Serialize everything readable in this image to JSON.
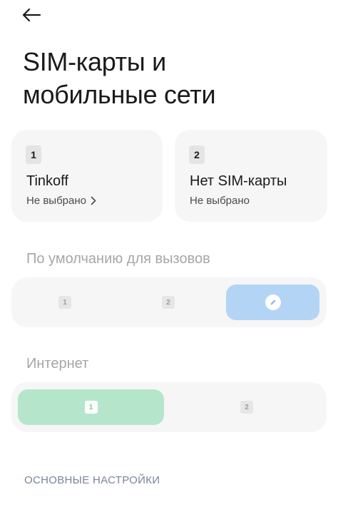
{
  "header": {
    "back_icon": "arrow-left-icon",
    "title_line1": "SIM-карты и",
    "title_line2": "мобильные сети"
  },
  "sim_cards": [
    {
      "slot": "1",
      "name": "Tinkoff",
      "status": "Не выбрано",
      "has_chevron": true
    },
    {
      "slot": "2",
      "name": "Нет SIM-карты",
      "status": "Не выбрано",
      "has_chevron": false
    }
  ],
  "calls_default": {
    "label": "По умолчанию для вызовов",
    "options": [
      {
        "badge": "1"
      },
      {
        "badge": "2"
      },
      {
        "icon": "pencil-icon",
        "selected": true
      }
    ],
    "selected_color": "#b3d4f5"
  },
  "internet": {
    "label": "Интернет",
    "options": [
      {
        "badge": "1",
        "selected": true
      },
      {
        "badge": "2"
      }
    ],
    "selected_color": "#b5e6cc"
  },
  "footer": {
    "section_title": "ОСНОВНЫЕ НАСТРОЙКИ"
  }
}
